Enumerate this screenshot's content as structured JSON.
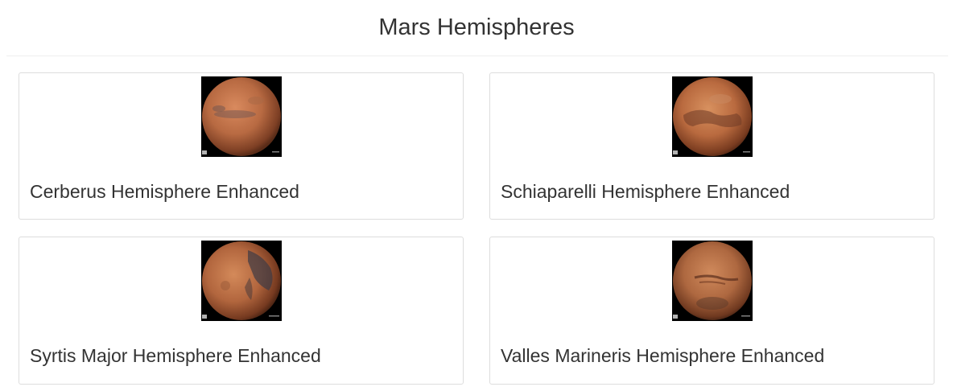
{
  "page": {
    "title": "Mars Hemispheres"
  },
  "hemispheres": [
    {
      "title": "Cerberus Hemisphere Enhanced",
      "icon": "mars-cerberus-image"
    },
    {
      "title": "Schiaparelli Hemisphere Enhanced",
      "icon": "mars-schiaparelli-image"
    },
    {
      "title": "Syrtis Major Hemisphere Enhanced",
      "icon": "mars-syrtis-major-image"
    },
    {
      "title": "Valles Marineris Hemisphere Enhanced",
      "icon": "mars-valles-marineris-image"
    }
  ],
  "colors": {
    "text": "#333333",
    "card_border": "#dddddd",
    "divider": "#eeeeee",
    "image_background": "#000000",
    "mars_surface": "#b8623a"
  }
}
